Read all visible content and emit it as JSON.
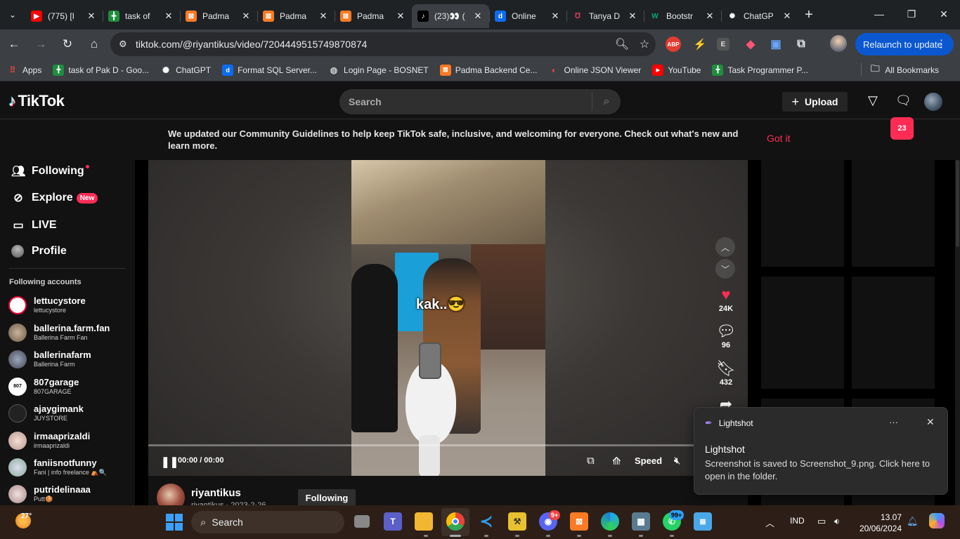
{
  "browser": {
    "tabs": [
      {
        "label": "(775) [I",
        "favicon": "youtube-icon",
        "color": "#ff0000"
      },
      {
        "label": "task of",
        "favicon": "sheets-icon",
        "color": "#1e8e3e"
      },
      {
        "label": "Padma",
        "favicon": "xampp-icon",
        "color": "#fb7a24"
      },
      {
        "label": "Padma",
        "favicon": "xampp-icon",
        "color": "#fb7a24"
      },
      {
        "label": "Padma",
        "favicon": "xampp-icon",
        "color": "#fb7a24"
      },
      {
        "label": "(23)👀 (",
        "favicon": "tiktok-icon",
        "color": "#000000"
      },
      {
        "label": "Online",
        "favicon": "d-icon",
        "color": "#0b6cf0"
      },
      {
        "label": "Tanya D",
        "favicon": "quora-icon",
        "color": "#b92b27"
      },
      {
        "label": "Bootstr",
        "favicon": "w-icon",
        "color": "#04aa6d"
      },
      {
        "label": "ChatGP",
        "favicon": "chatgpt-icon",
        "color": "#ffffff"
      }
    ],
    "url": "tiktok.com/@riyantikus/video/7204449515749870874",
    "relaunch_label": "Relaunch to update",
    "bookmarks": [
      {
        "label": "Apps"
      },
      {
        "label": "task of Pak D - Goo..."
      },
      {
        "label": "ChatGPT"
      },
      {
        "label": "Format SQL Server..."
      },
      {
        "label": "Login Page - BOSNET"
      },
      {
        "label": "Padma Backend Ce..."
      },
      {
        "label": "Online JSON Viewer"
      },
      {
        "label": "YouTube"
      },
      {
        "label": "Task Programmer P..."
      }
    ],
    "all_bookmarks": "All Bookmarks",
    "ext_abp": "ABP",
    "ext_e": "E"
  },
  "tiktok": {
    "logo": "TikTok",
    "search_placeholder": "Search",
    "upload_label": "Upload",
    "msg_badge": "23",
    "banner_text": "We updated our Community Guidelines to help keep TikTok safe, inclusive, and welcoming for everyone. Check out what's new and learn more.",
    "got_it": "Got it",
    "nav": {
      "following": "Following",
      "explore": "Explore",
      "new_badge": "New",
      "live": "LIVE",
      "profile": "Profile"
    },
    "following_accounts_title": "Following accounts",
    "accounts": [
      {
        "name": "lettucystore",
        "sub": "lettucystore"
      },
      {
        "name": "ballerina.farm.fan",
        "sub": "Ballerina Farm Fan"
      },
      {
        "name": "ballerinafarm",
        "sub": "Ballerina  Farm"
      },
      {
        "name": "807garage",
        "sub": "807GARAGE"
      },
      {
        "name": "ajaygimank",
        "sub": "JUYSTORE"
      },
      {
        "name": "irmaaprizaldi",
        "sub": "irmaaprizaldi"
      },
      {
        "name": "faniisnotfunny",
        "sub": "Fani | info freelance ⛺🔍"
      },
      {
        "name": "putridelinaaa",
        "sub": "Putt🍪"
      }
    ],
    "video": {
      "caption": "kak..😎",
      "time": "00:00 / 00:00",
      "speed": "Speed",
      "progress": 0
    },
    "actions": {
      "likes": "24K",
      "comments": "96",
      "saves": "432"
    },
    "author": {
      "name": "riyantikus",
      "sub": "riyantikus · 2023-2-26",
      "follow_label": "Following"
    }
  },
  "toast": {
    "app": "Lightshot",
    "more": "···",
    "title": "Lightshot",
    "body": "Screenshot is saved to Screenshot_9.png. Click here to open in the folder."
  },
  "taskbar": {
    "weather": "27°",
    "search": "Search",
    "discord_badge": "9+",
    "whatsapp_badge": "99+",
    "lang": "IND",
    "time": "13.07",
    "date": "20/06/2024"
  }
}
